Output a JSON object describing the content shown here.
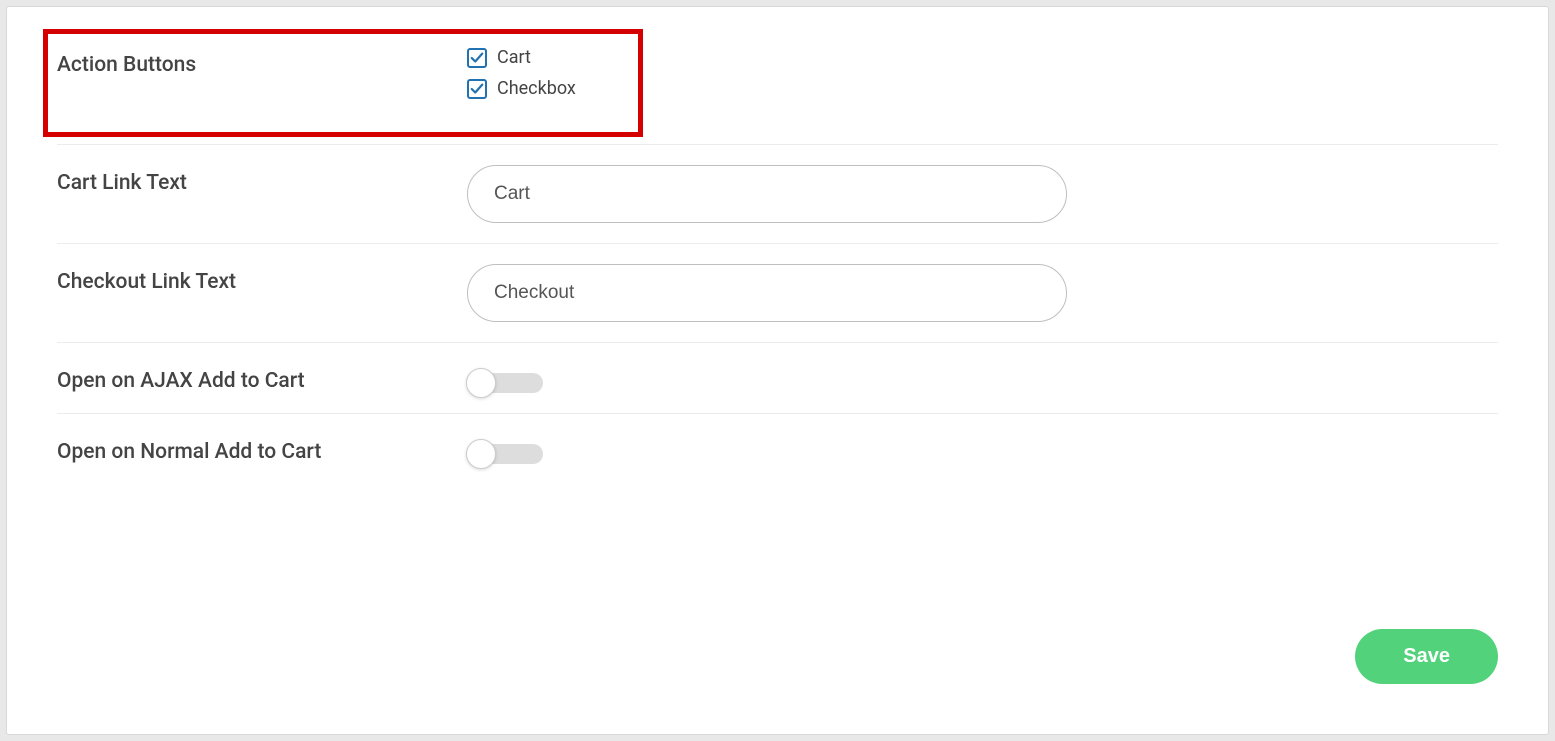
{
  "rows": {
    "action_buttons": {
      "label": "Action Buttons",
      "options": [
        {
          "label": "Cart",
          "checked": true
        },
        {
          "label": "Checkbox",
          "checked": true
        }
      ]
    },
    "cart_link_text": {
      "label": "Cart Link Text",
      "value": "Cart"
    },
    "checkout_link_text": {
      "label": "Checkout Link Text",
      "value": "Checkout"
    },
    "open_ajax": {
      "label": "Open on AJAX Add to Cart",
      "value": false
    },
    "open_normal": {
      "label": "Open on Normal Add to Cart",
      "value": false
    }
  },
  "buttons": {
    "save": "Save"
  }
}
